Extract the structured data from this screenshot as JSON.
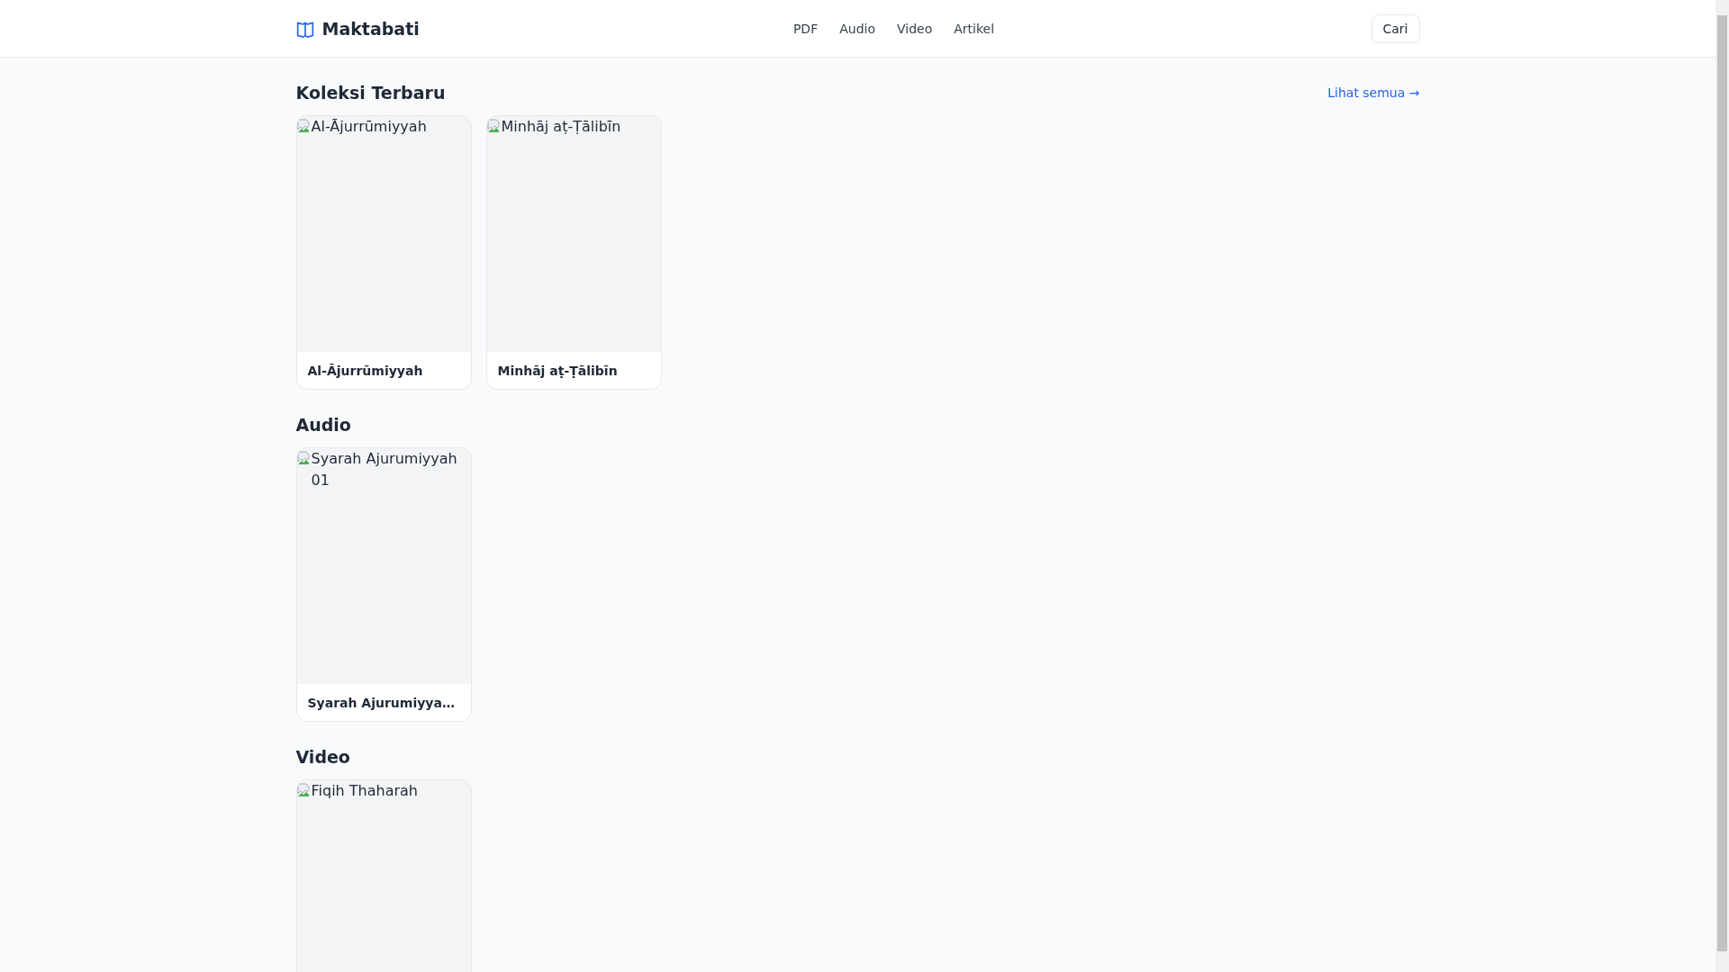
{
  "header": {
    "brand": "Maktabati",
    "nav": [
      {
        "label": "PDF"
      },
      {
        "label": "Audio"
      },
      {
        "label": "Video"
      },
      {
        "label": "Artikel"
      }
    ],
    "search_button": "Cari"
  },
  "sections": [
    {
      "title": "Koleksi Terbaru",
      "link": "Lihat semua →",
      "items": [
        {
          "image_alt": "Al-Ājurrūmiyyah",
          "title": "Al-Ājurrūmiyyah"
        },
        {
          "image_alt": "Minhāj aṭ-Ṭālibīn",
          "title": "Minhāj aṭ-Ṭālibīn"
        }
      ]
    },
    {
      "title": "Audio",
      "items": [
        {
          "image_alt": "Syarah Ajurumiyyah 01",
          "title": "Syarah Ajurumiyya…"
        }
      ]
    },
    {
      "title": "Video",
      "items": [
        {
          "image_alt": "Fiqih Thaharah"
        }
      ]
    }
  ]
}
